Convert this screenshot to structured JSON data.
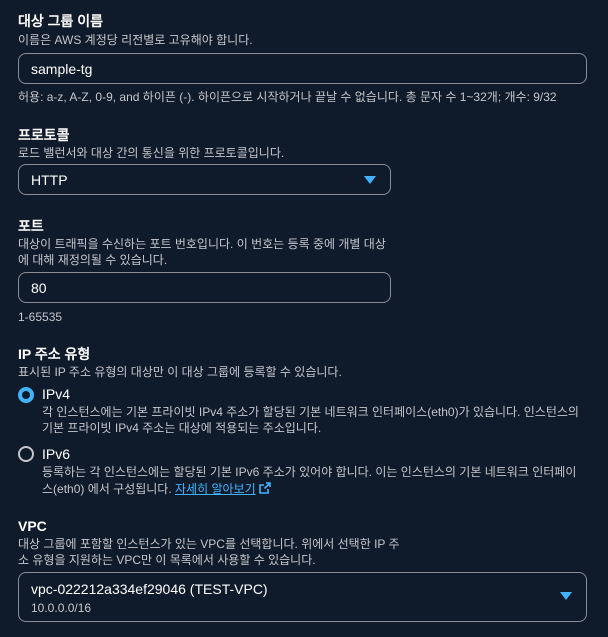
{
  "target_group_name": {
    "label": "대상 그룹 이름",
    "description": "이름은 AWS 계정당 리전별로 고유해야 합니다.",
    "value": "sample-tg",
    "hint": "허용: a-z, A-Z, 0-9, and 하이픈 (-). 하이픈으로 시작하거나 끝날 수 없습니다. 총 문자 수 1~32개; 개수: 9/32"
  },
  "protocol": {
    "label": "프로토콜",
    "description": "로드 밸런서와 대상 간의 통신을 위한 프로토콜입니다.",
    "value": "HTTP",
    "icon": "caret-down-icon"
  },
  "port": {
    "label": "포트",
    "description_line1": "대상이 트래픽을 수신하는 포트 번호입니다. 이 번호는 등록 중에 개별 대상",
    "description_line2": "에 대해 재정의될 수 있습니다.",
    "value": "80",
    "hint": "1-65535"
  },
  "ip_address_type": {
    "label": "IP 주소 유형",
    "description": "표시된 IP 주소 유형의 대상만 이 대상 그룹에 등록할 수 있습니다.",
    "options": [
      {
        "label": "IPv4",
        "checked": true,
        "desc_line1": "각 인스턴스에는 기본 프라이빗 IPv4 주소가 할당된 기본 네트워크 인터페이스(eth0)가 있습니다. 인스턴스의",
        "desc_line2": "기본 프라이빗 IPv4 주소는 대상에 적용되는 주소입니다."
      },
      {
        "label": "IPv6",
        "checked": false,
        "desc_line1": "등록하는 각 인스턴스에는 할당된 기본 IPv6 주소가 있어야 합니다. 이는 인스턴스의 기본 네트워크 인터페이",
        "desc_line2": "스(eth0) 에서 구성됩니다.",
        "link": "자세히 알아보기",
        "link_icon": "external-link-icon"
      }
    ]
  },
  "vpc": {
    "label": "VPC",
    "description_line1": "대상 그룹에 포함할 인스턴스가 있는 VPC를 선택합니다. 위에서 선택한 IP 주",
    "description_line2": "소 유형을 지원하는 VPC만 이 목록에서 사용할 수 있습니다.",
    "value": "vpc-022212a334ef29046 (TEST-VPC)",
    "sub_value": "10.0.0.0/16",
    "icon": "caret-down-icon"
  },
  "colors": {
    "background": "#0f1b2a",
    "accent": "#42b4ff",
    "border": "#8c8c94",
    "text": "#ffffff",
    "muted": "#c6c6cd"
  }
}
